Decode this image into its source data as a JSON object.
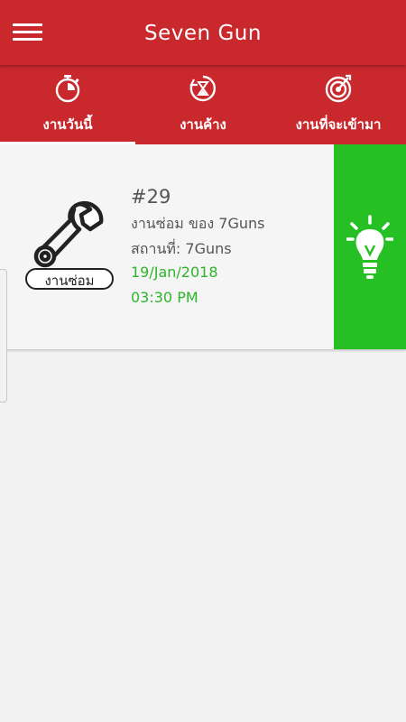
{
  "app_bar": {
    "title": "Seven Gun"
  },
  "tabs": [
    {
      "label": "งานวันนี้",
      "icon": "clock-icon",
      "selected": true
    },
    {
      "label": "งานค้าง",
      "icon": "hourglass-icon",
      "selected": false
    },
    {
      "label": "งานที่จะเข้ามา",
      "icon": "target-icon",
      "selected": false
    }
  ],
  "job": {
    "number": "#29",
    "title": "งานซ่อม ของ 7Guns",
    "location": "สถานที่: 7Guns",
    "date": "19/Jan/2018",
    "time": "03:30 PM",
    "type_label": "งานซ่อม",
    "type_icon": "wrench-icon",
    "action_icon": "lightbulb-icon"
  },
  "colors": {
    "primary": "#c9282d",
    "action": "#27c024",
    "date_text": "#2db52a",
    "background": "#f2f2f2"
  }
}
